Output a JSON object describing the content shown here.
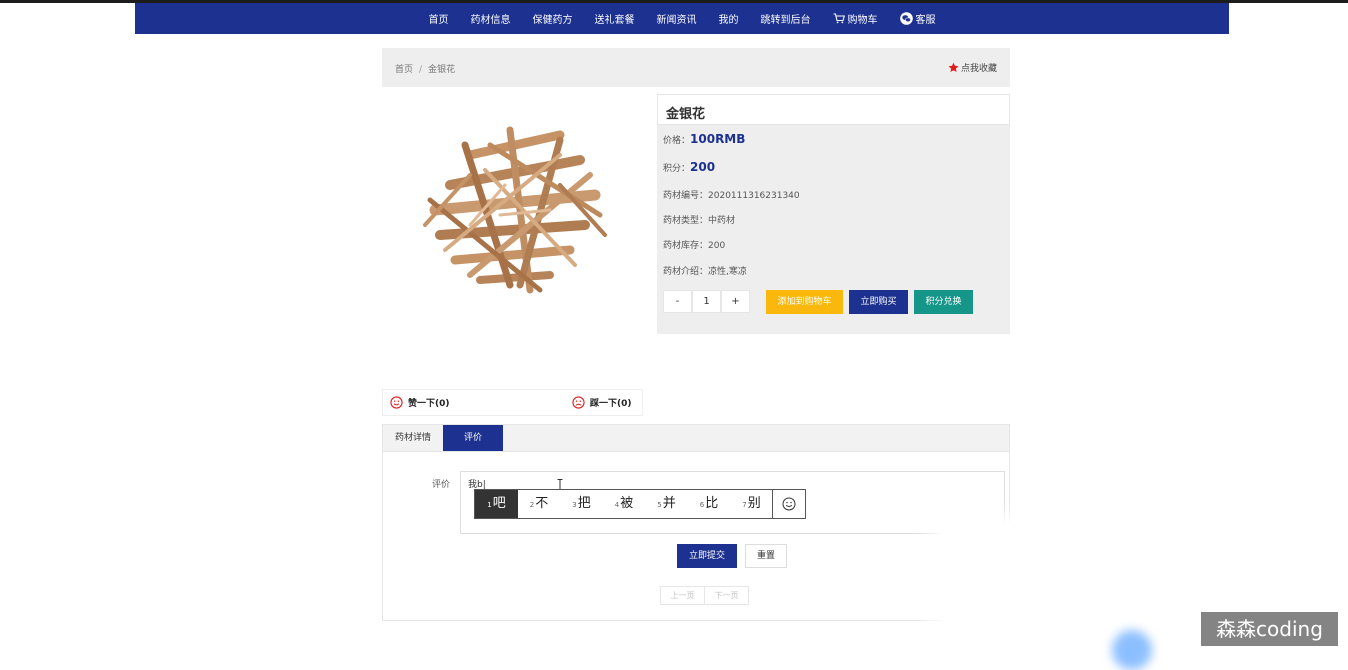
{
  "nav": {
    "items": [
      "首页",
      "药材信息",
      "保健药方",
      "送礼套餐",
      "新闻资讯",
      "我的",
      "跳转到后台"
    ],
    "cart": "购物车",
    "service": "客服"
  },
  "breadcrumb": {
    "home": "首页",
    "sep": "/",
    "current": "金银花",
    "favorite": "点我收藏"
  },
  "product": {
    "name": "金银花",
    "price_label": "价格：",
    "price": "100RMB",
    "points_label": "积分：",
    "points": "200",
    "code_label": "药材编号：",
    "code": "2020111316231340",
    "type_label": "药材类型：",
    "type": "中药材",
    "stock_label": "药材库存：",
    "stock": "200",
    "intro_label": "药材介绍：",
    "intro": "凉性,寒凉",
    "quantity": {
      "minus": "-",
      "value": "1",
      "plus": "+"
    },
    "buttons": {
      "add_cart": "添加到购物车",
      "buy_now": "立即购买",
      "exchange": "积分兑换"
    }
  },
  "votes": {
    "like": "赞一下(0)",
    "dislike": "踩一下(0)"
  },
  "tabs": {
    "detail": "药材详情",
    "review": "评价"
  },
  "review": {
    "label": "评价",
    "input_value": "我b|",
    "ime_candidates": [
      {
        "n": "1",
        "t": "吧"
      },
      {
        "n": "2",
        "t": "不"
      },
      {
        "n": "3",
        "t": "把"
      },
      {
        "n": "4",
        "t": "被"
      },
      {
        "n": "5",
        "t": "并"
      },
      {
        "n": "6",
        "t": "比"
      },
      {
        "n": "7",
        "t": "别"
      }
    ],
    "submit": "立即提交",
    "reset": "重置",
    "pager": {
      "prev": "上一页",
      "next": "下一页"
    }
  },
  "watermark": "森森coding",
  "colors": {
    "nav": "#1c3190",
    "cart_btn": "#fbb80c",
    "buy_btn": "#1c3190",
    "exchange_btn": "#159688",
    "price": "#1c3190"
  }
}
